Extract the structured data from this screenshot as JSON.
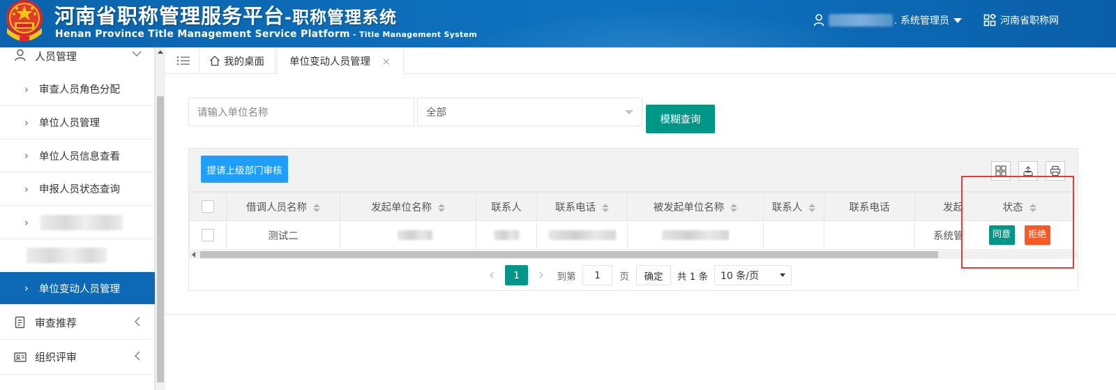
{
  "header": {
    "title_cn": "河南省职称管理服务平台",
    "title_cn_dash": "-",
    "title_cn_sub": "职称管理系统",
    "title_en": "Henan Province Title Management Service Platform",
    "title_en_dash": " - ",
    "title_en_sub": "Title Management System",
    "user_role": ". 系统管理员",
    "site_link": "河南省职称网"
  },
  "sidebar": {
    "group_people": "人员管理",
    "items": [
      {
        "label": "审查人员角色分配"
      },
      {
        "label": "单位人员管理"
      },
      {
        "label": "单位人员信息查看"
      },
      {
        "label": "申报人员状态查询"
      },
      {
        "label": "单位变动人员管理"
      }
    ],
    "group_review": "审查推荐",
    "group_organize": "组织评审"
  },
  "tabs": {
    "home": "我的桌面",
    "current": "单位变动人员管理"
  },
  "search": {
    "name_placeholder": "请输入单位名称",
    "select_value": "全部",
    "search_button": "模糊查询"
  },
  "toolbar": {
    "submit_button": "提请上级部门审核"
  },
  "table": {
    "columns": [
      "借调人员名称",
      "发起单位名称",
      "联系人",
      "联系电话",
      "被发起单位名称",
      "联系人",
      "联系电话",
      "发起",
      "状态"
    ],
    "rows": [
      {
        "name": "测试二",
        "initiator": "系统管",
        "agree": "同意",
        "reject": "拒绝"
      }
    ]
  },
  "pager": {
    "prev": "‹",
    "current_page": "1",
    "next": "›",
    "goto_label": "到第",
    "goto_value": "1",
    "page_unit": "页",
    "confirm": "确定",
    "total": "共 1 条",
    "page_size": "10 条/页"
  },
  "colors": {
    "header_blue": "#0e72c0",
    "active_menu": "#0d68b5",
    "primary_green": "#009688",
    "primary_blue": "#1e9fff",
    "danger_orange": "#ff5722",
    "annotation_red": "#e53935"
  }
}
